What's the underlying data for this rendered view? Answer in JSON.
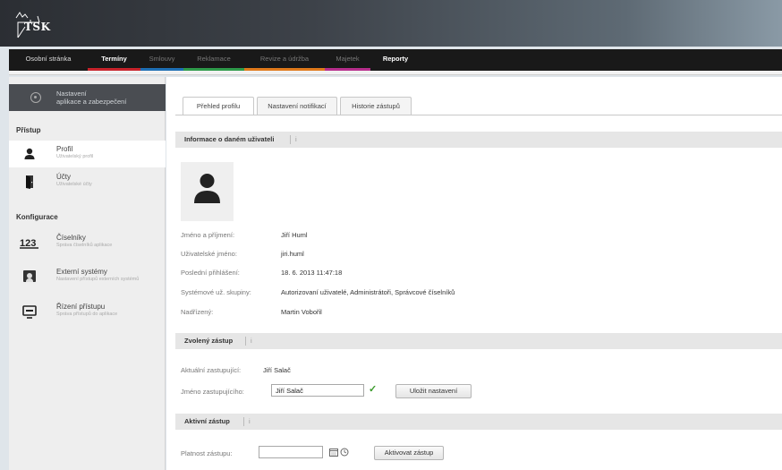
{
  "logo": {
    "text": "TSK"
  },
  "nav": [
    {
      "label": "Osobní stránka",
      "style": "normal",
      "bar": ""
    },
    {
      "label": "Termíny",
      "style": "bold",
      "bar": "#c8232b"
    },
    {
      "label": "Smlouvy",
      "style": "dim",
      "bar": "#1e6fb4"
    },
    {
      "label": "Reklamace",
      "style": "dim",
      "bar": "#2e9a4a"
    },
    {
      "label": "Revize a údržba",
      "style": "dim",
      "bar": "#e07a1b"
    },
    {
      "label": "Majetek",
      "style": "dim",
      "bar": "#b62e8c"
    },
    {
      "label": "Reporty",
      "style": "bold",
      "bar": ""
    }
  ],
  "sidebar": {
    "top_label_line1": "Nastavení",
    "top_label_line2": "aplikace a zabezpečení",
    "section_access": "Přístup",
    "section_config": "Konfigurace",
    "items": [
      {
        "title": "Profil",
        "subtitle": "Uživatelský profil",
        "icon": "user-icon"
      },
      {
        "title": "Účty",
        "subtitle": "Uživatelské účty",
        "icon": "door-icon"
      },
      {
        "title": "Číselníky",
        "subtitle": "Správa číselníků aplikace",
        "icon": "numbers-icon"
      },
      {
        "title": "Externí systémy",
        "subtitle": "Nastavení přístupů externích systémů",
        "icon": "external-systems-icon"
      },
      {
        "title": "Řízení přístupu",
        "subtitle": "Správa přístupů do aplikace",
        "icon": "access-icon"
      }
    ]
  },
  "tabs": [
    {
      "label": "Přehled profilu"
    },
    {
      "label": "Nastavení notifikací"
    },
    {
      "label": "Historie zástupů"
    }
  ],
  "user_info": {
    "header": "Informace o daném uživateli",
    "info_mark": "i",
    "rows": [
      {
        "label": "Jméno a příjmení:",
        "value": "Jiří Huml"
      },
      {
        "label": "Uživatelské jméno:",
        "value": "jiri.huml"
      },
      {
        "label": "Poslední přihlášení:",
        "value": "18. 6. 2013 11:47:18"
      },
      {
        "label": "Systémové už. skupiny:",
        "value": "Autorizovaní uživatelé, Administrátoři, Správcové číselníků"
      },
      {
        "label": "Nadřízený:",
        "value": "Martin Vobořil"
      }
    ]
  },
  "deputy": {
    "header": "Zvolený zástup",
    "info_mark": "i",
    "current_label": "Aktuální zastupující:",
    "current_value": "Jiří Salač",
    "name_label": "Jméno zastupujícího:",
    "name_value": "Jiří Salač",
    "save_label": "Uložit nastavení"
  },
  "active": {
    "header": "Aktivní zástup",
    "info_mark": "i",
    "validity_label": "Platnost zástupu:",
    "activate_label": "Aktivovat zástup"
  }
}
